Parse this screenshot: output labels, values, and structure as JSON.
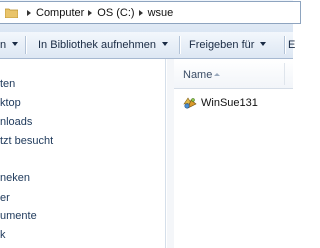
{
  "address": {
    "crumbs": [
      "Computer",
      "OS (C:)",
      "wsue"
    ]
  },
  "toolbar": {
    "cut_left_label": "n",
    "library_label": "In Bibliothek aufnehmen",
    "share_label": "Freigeben für",
    "cut_right_label": "E"
  },
  "nav": {
    "items": [
      "ten",
      "ktop",
      "nloads",
      "tzt besucht",
      "neken",
      "er",
      "umente",
      "k"
    ]
  },
  "content": {
    "column_name": "Name",
    "files": [
      {
        "name": "WinSue131",
        "icon": "application-icon"
      }
    ]
  },
  "colors": {
    "nav_text": "#1e395b",
    "toolbar_bg": "#dde7f3"
  }
}
